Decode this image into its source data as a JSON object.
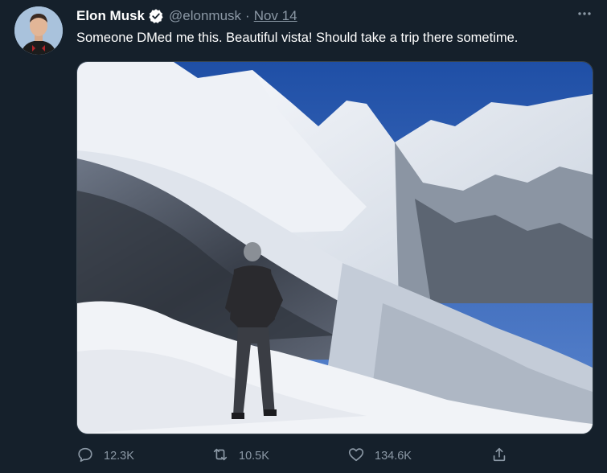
{
  "tweet": {
    "author_name": "Elon Musk",
    "handle": "@elonmusk",
    "separator": "·",
    "date": "Nov 14",
    "text": "Someone DMed me this. Beautiful vista! Should take a trip there sometime.",
    "verified": true
  },
  "actions": {
    "reply_count": "12.3K",
    "retweet_count": "10.5K",
    "like_count": "134.6K"
  },
  "icons": {
    "reply": "speech-bubble-icon",
    "retweet": "retweet-icon",
    "like": "heart-icon",
    "share": "share-upload-icon",
    "more": "more-horizontal-icon",
    "verified": "verified-badge-icon"
  },
  "colors": {
    "background": "#15202b",
    "secondary_text": "#8b98a5",
    "primary_text": "#ffffff",
    "verified_badge": "#ffffff"
  }
}
